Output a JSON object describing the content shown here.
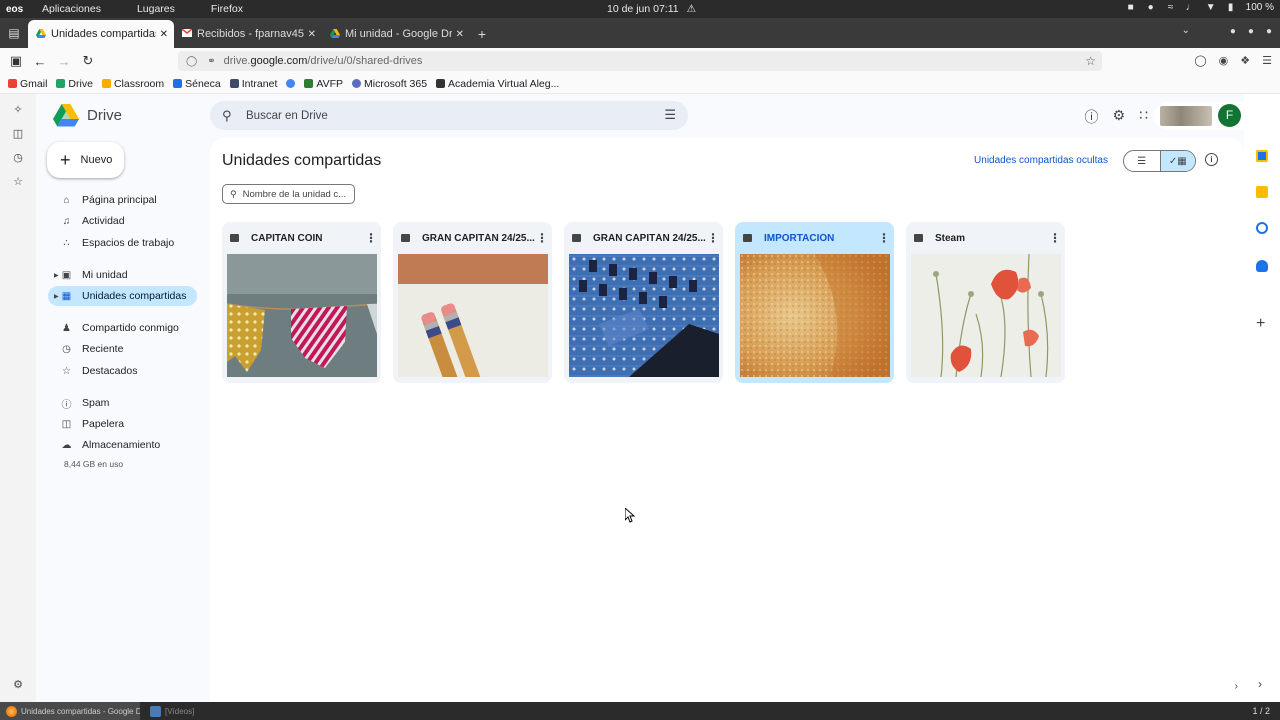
{
  "os": {
    "logo": "eos",
    "menu": [
      "Aplicaciones",
      "Lugares",
      "Firefox"
    ],
    "clock": "10 de jun  07:11",
    "battery": "100 %"
  },
  "browser": {
    "tabs": [
      {
        "label": "Unidades compartidas - G"
      },
      {
        "label": "Recibidos - fparnav450@"
      },
      {
        "label": "Mi unidad - Google Drive"
      }
    ],
    "url_prefix": "drive.",
    "url_host": "google.com",
    "url_path": "/drive/u/0/shared-drives",
    "bookmarks": [
      {
        "label": "Gmail",
        "color": "#ea4335"
      },
      {
        "label": "Drive",
        "color": "#1fa463"
      },
      {
        "label": "Classroom",
        "color": "#f9ab00"
      },
      {
        "label": "Séneca",
        "color": "#1a73e8"
      },
      {
        "label": "Intranet",
        "color": "#3c4a6b"
      },
      {
        "label": "",
        "color": "#4285f4"
      },
      {
        "label": "AVFP",
        "color": "#2e7d32"
      },
      {
        "label": "Microsoft 365",
        "color": "#5c6bc0"
      },
      {
        "label": "Academia Virtual Aleg...",
        "color": "#333333"
      }
    ]
  },
  "drive": {
    "app_name": "Drive",
    "search_placeholder": "Buscar en Drive",
    "avatar_letter": "F",
    "new_button": "Nuevo",
    "nav": [
      {
        "label": "Página principal",
        "icon": "home-icon"
      },
      {
        "label": "Actividad",
        "icon": "bell-icon"
      },
      {
        "label": "Espacios de trabajo",
        "icon": "workspaces-icon"
      },
      {
        "label": "Mi unidad",
        "icon": "my-drive-icon"
      },
      {
        "label": "Unidades compartidas",
        "icon": "shared-drives-icon"
      },
      {
        "label": "Compartido conmigo",
        "icon": "people-icon"
      },
      {
        "label": "Reciente",
        "icon": "clock-icon"
      },
      {
        "label": "Destacados",
        "icon": "star-icon"
      },
      {
        "label": "Spam",
        "icon": "spam-icon"
      },
      {
        "label": "Papelera",
        "icon": "trash-icon"
      },
      {
        "label": "Almacenamiento",
        "icon": "cloud-icon"
      }
    ],
    "storage_used": "8,44 GB en uso",
    "page_title": "Unidades compartidas",
    "hidden_link": "Unidades compartidas ocultas",
    "filter_placeholder": "Nombre de la unidad c...",
    "cards": [
      {
        "title": "CAPITAN COIN",
        "image": "bunting-flags"
      },
      {
        "title": "GRAN CAPITÁN 24/25...",
        "image": "pencils"
      },
      {
        "title": "GRAN CAPITÁN 24/25...",
        "image": "circuit-board"
      },
      {
        "title": "IMPORTACIÓN",
        "image": "bread-crust"
      },
      {
        "title": "Steam",
        "image": "poppies"
      }
    ]
  },
  "taskbar": {
    "items": [
      "Unidades compartidas - Google D...",
      "[Vídeos]"
    ],
    "workspace": "1 / 2"
  }
}
